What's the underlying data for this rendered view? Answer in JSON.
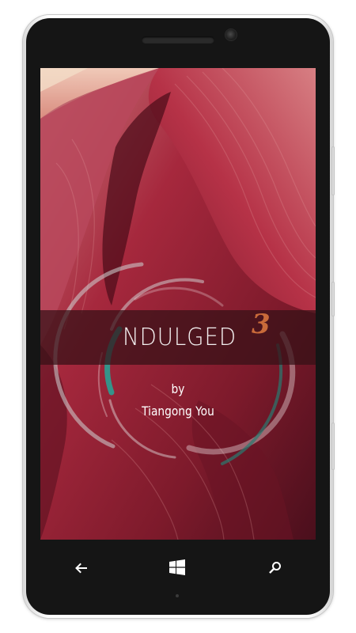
{
  "cover": {
    "title": "NDULGED",
    "number": "3",
    "by": "by",
    "author": "Tiangong You"
  },
  "nav": {
    "back": "back-arrow-icon",
    "home": "windows-logo-icon",
    "search": "search-icon"
  },
  "colors": {
    "screen_bg": "#7a1e2a",
    "accent_number": "#c96a3a",
    "accent_ring": "#2f9a8e",
    "phone_body": "#151515"
  }
}
